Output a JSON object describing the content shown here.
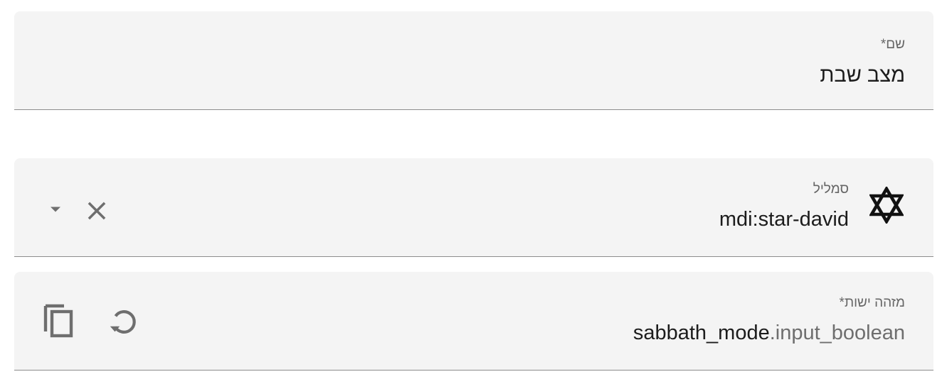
{
  "name_field": {
    "label": "שם*",
    "value": "מצב שבת"
  },
  "icon_field": {
    "label": "סמליל",
    "value": "mdi:star-david",
    "icon": "star-david-icon",
    "actions": [
      "dropdown-arrow-icon",
      "close-icon"
    ]
  },
  "entity_id_field": {
    "label": "מזהה ישות*",
    "value_main": "sabbath_mode",
    "value_suffix": ".input_boolean",
    "actions": [
      "copy-icon",
      "refresh-icon"
    ]
  },
  "colors": {
    "field_background": "#f4f4f4",
    "underline": "#8c8c8c",
    "label": "#666666",
    "text": "#1c1c1c",
    "icon": "#6e6e6e"
  }
}
